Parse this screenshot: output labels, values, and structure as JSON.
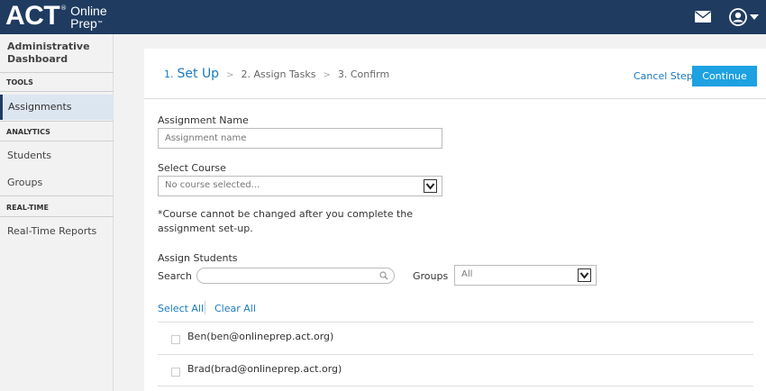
{
  "header": {
    "logo_main": "ACT",
    "logo_tm": "®",
    "logo_sub_line1": "Online",
    "logo_sub_line2": "Prep",
    "logo_sub_tm": "™",
    "icons": [
      "mail-icon",
      "user-icon",
      "caret-down-icon"
    ],
    "bar_color": "#1f3b60"
  },
  "sidebar": {
    "title": "Administrative Dashboard",
    "sections": [
      {
        "heading": "TOOLS",
        "items": [
          {
            "label": "Assignments",
            "active": true
          }
        ]
      },
      {
        "heading": "ANALYTICS",
        "items": [
          {
            "label": "Students",
            "active": false
          },
          {
            "label": "Groups",
            "active": false
          }
        ]
      },
      {
        "heading": "REAL-TIME",
        "items": [
          {
            "label": "Real-Time Reports",
            "active": false
          }
        ]
      }
    ]
  },
  "wizard": {
    "step1_num": "1.",
    "step1_label": "Set Up",
    "separator": ">",
    "step2": "2. Assign Tasks",
    "step3": "3. Confirm",
    "cancel_label": "Cancel Step",
    "continue_label": "Continue",
    "accent_color": "#1a7bc0",
    "button_color": "#1da1e1"
  },
  "form": {
    "assignment_name_label": "Assignment Name",
    "assignment_name_placeholder": "Assignment name",
    "assignment_name_value": "",
    "select_course_label": "Select Course",
    "select_course_value": "No course selected...",
    "course_note": "*Course cannot be changed after you complete the assignment set-up.",
    "assign_students_label": "Assign Students",
    "search_label": "Search",
    "search_value": "",
    "groups_label": "Groups",
    "groups_value": "All",
    "select_all_label": "Select All",
    "clear_all_label": "Clear All"
  },
  "students": [
    {
      "label": "Ben(ben@onlineprep.act.org)",
      "checked": false
    },
    {
      "label": "Brad(brad@onlineprep.act.org)",
      "checked": false
    }
  ]
}
